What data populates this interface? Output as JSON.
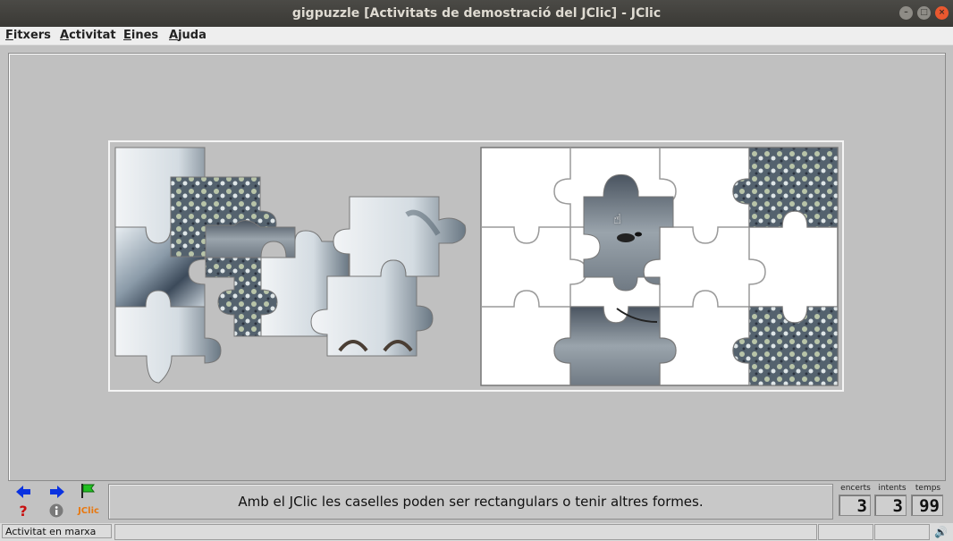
{
  "window": {
    "title": "gigpuzzle [Activitats de demostració del JClic] - JClic"
  },
  "menu": {
    "items": [
      {
        "label": "Fitxers",
        "first": "F",
        "rest": "itxers"
      },
      {
        "label": "Activitat",
        "first": "A",
        "rest": "ctivitat"
      },
      {
        "label": "Eines",
        "first": "E",
        "rest": "ines"
      },
      {
        "label": "Ajuda",
        "first": "A",
        "rest": "juda"
      }
    ]
  },
  "icons": {
    "prev": "arrow-left-icon",
    "next": "arrow-right-icon",
    "reset": "green-flag-icon",
    "help": "question-icon",
    "info": "info-icon",
    "jclic": "jclic-logo",
    "sound": "speaker-icon"
  },
  "brand": {
    "logo_text": "JClic"
  },
  "colors": {
    "arrow": "#0a32e0",
    "flag": "#22c022",
    "question": "#c81010",
    "logo": "#e87810"
  },
  "message": "Amb el JClic les caselles poden ser rectangulars o tenir altres formes.",
  "counters": {
    "encerts": {
      "label": "encerts",
      "value": "3"
    },
    "intents": {
      "label": "intents",
      "value": "3"
    },
    "temps": {
      "label": "temps",
      "value": "99"
    }
  },
  "status": {
    "text": "Activitat en marxa"
  }
}
